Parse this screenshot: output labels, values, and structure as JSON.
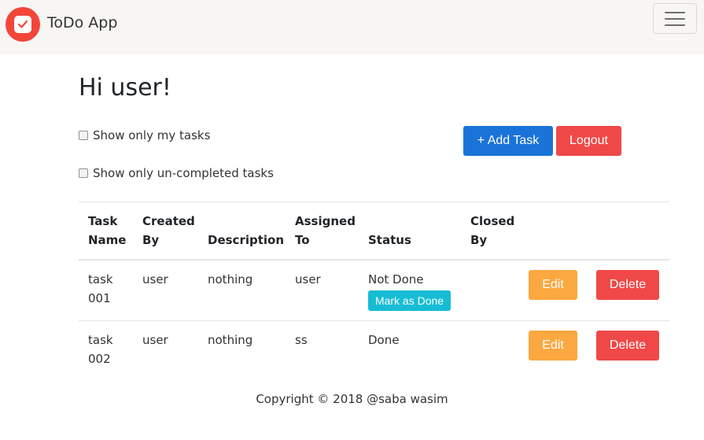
{
  "navbar": {
    "brand": "ToDo App",
    "logo_icon": "todo-check-icon",
    "logo_color": "#f2463a",
    "menu_icon": "hamburger-menu-icon"
  },
  "greeting": "Hi user!",
  "filters": {
    "my_tasks_label": "Show only my tasks",
    "uncompleted_label": "Show only un-completed tasks"
  },
  "actions": {
    "add_label": "+ Add Task",
    "logout_label": "Logout"
  },
  "table": {
    "headers": {
      "task_name": [
        "Task",
        "Name"
      ],
      "created_by": [
        "Created",
        "By"
      ],
      "description": "Description",
      "assigned_to": [
        "Assigned",
        "To"
      ],
      "status": "Status",
      "closed_by": [
        "Closed",
        "By"
      ]
    },
    "rows": [
      {
        "task_name": [
          "task",
          "001"
        ],
        "created_by": "user",
        "description": "nothing",
        "assigned_to": "user",
        "status": "Not Done",
        "mark_label": "Mark as Done",
        "closed_by": "",
        "edit_label": "Edit",
        "delete_label": "Delete"
      },
      {
        "task_name": [
          "task",
          "002"
        ],
        "created_by": "user",
        "description": "nothing",
        "assigned_to": "ss",
        "status": "Done",
        "closed_by": "",
        "edit_label": "Edit",
        "delete_label": "Delete"
      }
    ]
  },
  "footer": "Copyright © 2018 @saba wasim",
  "colors": {
    "primary": "#1a73d9",
    "danger": "#f04848",
    "warning": "#fba840",
    "info": "#17bcd4",
    "navbar_bg": "#f7f6f3"
  }
}
